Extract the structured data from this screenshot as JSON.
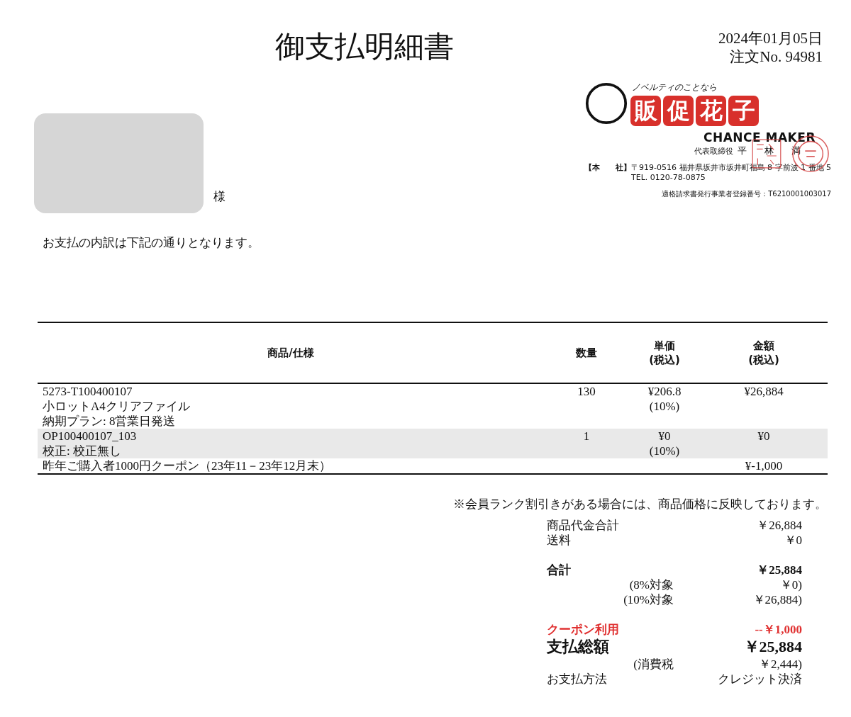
{
  "header": {
    "title": "御支払明細書",
    "date": "2024年01月05日",
    "order_no": "注文No. 94981"
  },
  "company": {
    "tagline": "ノベルティのことなら",
    "logo_chars": [
      "販",
      "促",
      "花",
      "子"
    ],
    "name": "CHANCE MAKER",
    "rep_title": "代表取締役",
    "rep_name": "平　林　満",
    "address_label": "【本　　社】",
    "address": "〒919-0516 福井県坂井市坂井町福島 8 字前波 1 番地 5",
    "tel": "TEL. 0120-78-0875",
    "registration": "適格請求書発行事業者登録番号：T6210001003017"
  },
  "customer": {
    "honorific": "様"
  },
  "intro": "お支払の内訳は下記の通りとなります。",
  "table": {
    "columns": [
      {
        "lines": [
          "商品/仕様"
        ]
      },
      {
        "lines": [
          "数量"
        ]
      },
      {
        "lines": [
          "単価",
          "(税込)"
        ]
      },
      {
        "lines": [
          "金額",
          "(税込)"
        ]
      }
    ],
    "rows": [
      {
        "shaded": false,
        "lines": [
          "5273-T100400107",
          "小ロットA4クリアファイル",
          "納期プラン: 8営業日発送"
        ],
        "quantity": "130",
        "unit_price": "¥206.8",
        "tax_rate": "(10%)",
        "amount": "¥26,884"
      },
      {
        "shaded": true,
        "lines": [
          "OP100400107_103",
          "校正: 校正無し"
        ],
        "quantity": "1",
        "unit_price": "¥0",
        "tax_rate": "(10%)",
        "amount": "¥0"
      },
      {
        "shaded": false,
        "lines": [
          "昨年ご購入者1000円クーポン（23年11－23年12月末）"
        ],
        "amount": "¥-1,000"
      }
    ]
  },
  "note": "※会員ランク割引きがある場合には、商品価格に反映しております。",
  "summary": [
    {
      "kind": "item",
      "label": "商品代金合計",
      "value": "￥26,884"
    },
    {
      "kind": "item",
      "label": "送料",
      "value": "￥0"
    },
    {
      "kind": "total",
      "label": "合計",
      "value": "￥25,884"
    },
    {
      "kind": "breakdown",
      "label": "(8%対象",
      "value": "￥0)"
    },
    {
      "kind": "breakdown",
      "label": "(10%対象",
      "value": "￥26,884)"
    },
    {
      "kind": "coupon",
      "label": "クーポン利用",
      "value": "--￥1,000"
    },
    {
      "kind": "grand",
      "label": "支払総額",
      "value": "￥25,884"
    },
    {
      "kind": "breakdown",
      "label": "(消費税",
      "value": "￥2,444)"
    },
    {
      "kind": "item",
      "label": "お支払方法",
      "value": "クレジット決済"
    }
  ]
}
